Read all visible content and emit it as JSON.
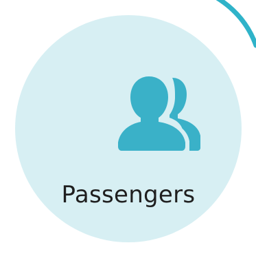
{
  "tile": {
    "label": "Passengers",
    "icon": "passengers-icon",
    "icon_color": "#3ab1c8",
    "background_color": "#d7eff3",
    "accent_ring_color": "#2fb3c9"
  }
}
